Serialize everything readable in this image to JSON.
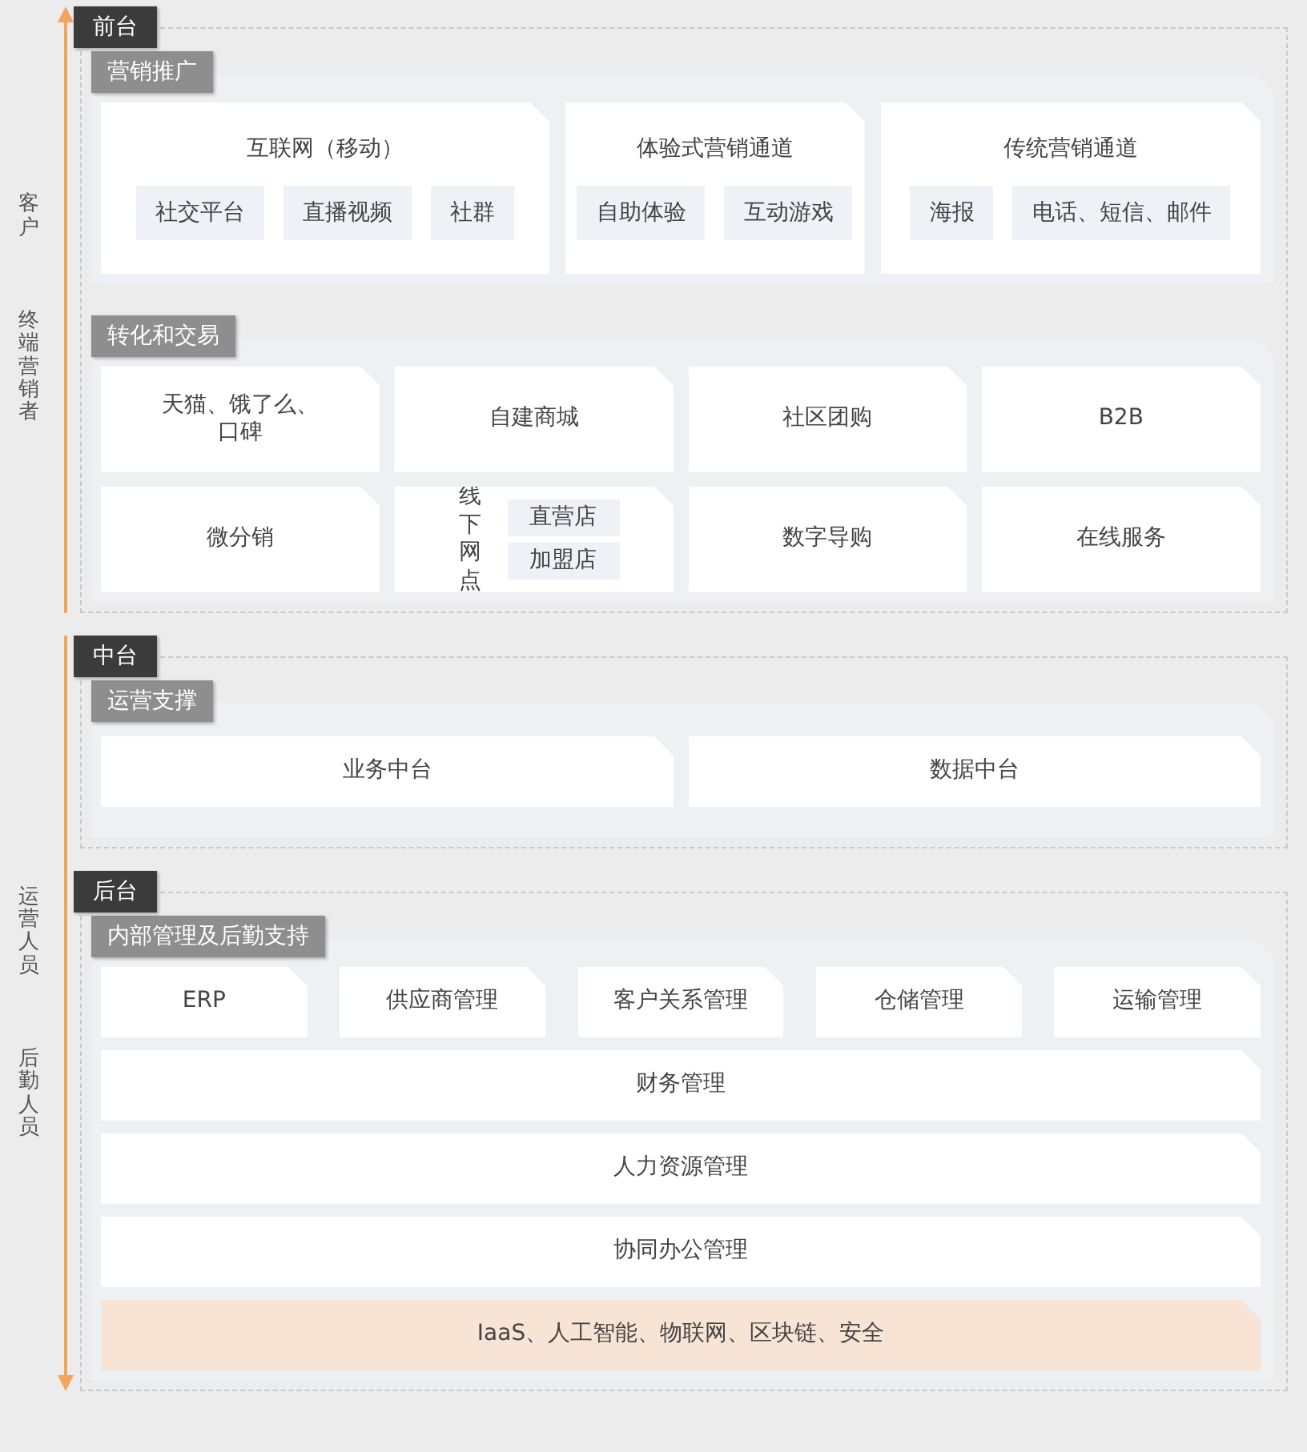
{
  "audiences": [
    {
      "kind": "upward",
      "labels": [
        "客户",
        "终端营销者"
      ],
      "layers": [
        {
          "title": "前台",
          "sections": [
            {
              "title": "营销推广",
              "kind": "channels",
              "groups": [
                {
                  "title": "互联网（移动）",
                  "items": [
                    "社交平台",
                    "直播视频",
                    "社群"
                  ]
                },
                {
                  "title": "体验式营销通道",
                  "items": [
                    "自助体验",
                    "互动游戏"
                  ]
                },
                {
                  "title": "传统营销通道",
                  "items": [
                    "海报",
                    "电话、短信、邮件"
                  ]
                }
              ]
            },
            {
              "title": "转化和交易",
              "kind": "grid",
              "cards": [
                {
                  "kind": "plain",
                  "label": "天猫、饿了么、口碑"
                },
                {
                  "kind": "plain",
                  "label": "自建商城"
                },
                {
                  "kind": "plain",
                  "label": "社区团购"
                },
                {
                  "kind": "plain",
                  "label": "B2B"
                },
                {
                  "kind": "plain",
                  "label": "微分销"
                },
                {
                  "kind": "split",
                  "label": "线下网点",
                  "items": [
                    "直营店",
                    "加盟店"
                  ]
                },
                {
                  "kind": "plain",
                  "label": "数字导购"
                },
                {
                  "kind": "plain",
                  "label": "在线服务"
                }
              ]
            }
          ]
        }
      ]
    },
    {
      "kind": "downward",
      "labels": [
        "运营人员",
        "后勤人员"
      ],
      "layers": [
        {
          "title": "中台",
          "sections": [
            {
              "title": "运营支撑",
              "kind": "grid",
              "cards": [
                {
                  "kind": "plain",
                  "label": "业务中台"
                },
                {
                  "kind": "plain",
                  "label": "数据中台"
                }
              ]
            }
          ]
        },
        {
          "title": "后台",
          "sections": [
            {
              "title": "内部管理及后勤支持",
              "kind": "stack",
              "rows": [
                {
                  "kind": "plain",
                  "cards": [
                    "ERP",
                    "供应商管理",
                    "客户关系管理",
                    "仓储管理",
                    "运输管理"
                  ]
                },
                {
                  "kind": "plain",
                  "cards": [
                    "财务管理"
                  ]
                },
                {
                  "kind": "plain",
                  "cards": [
                    "人力资源管理"
                  ]
                },
                {
                  "kind": "plain",
                  "cards": [
                    "协同办公管理"
                  ]
                },
                {
                  "kind": "highlight",
                  "cards": [
                    "IaaS、人工智能、物联网、区块链、安全"
                  ]
                }
              ]
            }
          ]
        }
      ]
    }
  ]
}
